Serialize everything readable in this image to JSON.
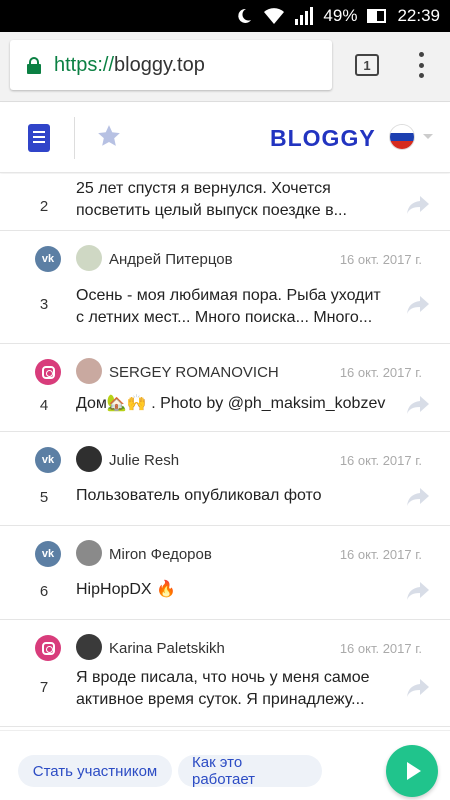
{
  "status_bar": {
    "battery": "49%",
    "time": "22:39"
  },
  "browser": {
    "url_scheme": "https://",
    "url_host": "bloggy.top",
    "tab_count": "1"
  },
  "header": {
    "brand": "BLOGGY"
  },
  "feed": [
    {
      "num": "2",
      "network": "",
      "author": "",
      "date": "",
      "text": [
        "25 лет спустя я вернулся. Хочется",
        "посветить целый выпуск поездке в..."
      ]
    },
    {
      "num": "3",
      "network": "vk",
      "author": "Андрей Питерцов",
      "date": "16 окт. 2017 г.",
      "text": [
        "Осень - моя любимая пора. Рыба уходит",
        "с летних мест... Много поиска... Много..."
      ]
    },
    {
      "num": "4",
      "network": "instagram",
      "author": "SERGEY ROMANOVICH",
      "date": "16 окт. 2017 г.",
      "text": [
        "Дом🏡🙌 . Photo by @ph_maksim_kobzev"
      ]
    },
    {
      "num": "5",
      "network": "vk",
      "author": "Julie Resh",
      "date": "16 окт. 2017 г.",
      "text": [
        "Пользователь опубликовал фото"
      ]
    },
    {
      "num": "6",
      "network": "vk",
      "author": "Miron Федоров",
      "date": "16 окт. 2017 г.",
      "text": [
        "HipHopDX 🔥"
      ]
    },
    {
      "num": "7",
      "network": "instagram",
      "author": "Karina Paletskikh",
      "date": "16 окт. 2017 г.",
      "text": [
        "Я вроде писала, что ночь у меня самое",
        "активное время суток. Я принадлежу..."
      ]
    }
  ],
  "bottom": {
    "join_label": "Стать участником",
    "how_label": "Как это работает"
  },
  "colors": {
    "brand": "#2234c0",
    "accent_green": "#20c48c",
    "vk": "#5c7fa4",
    "instagram": "#d83c7b"
  }
}
